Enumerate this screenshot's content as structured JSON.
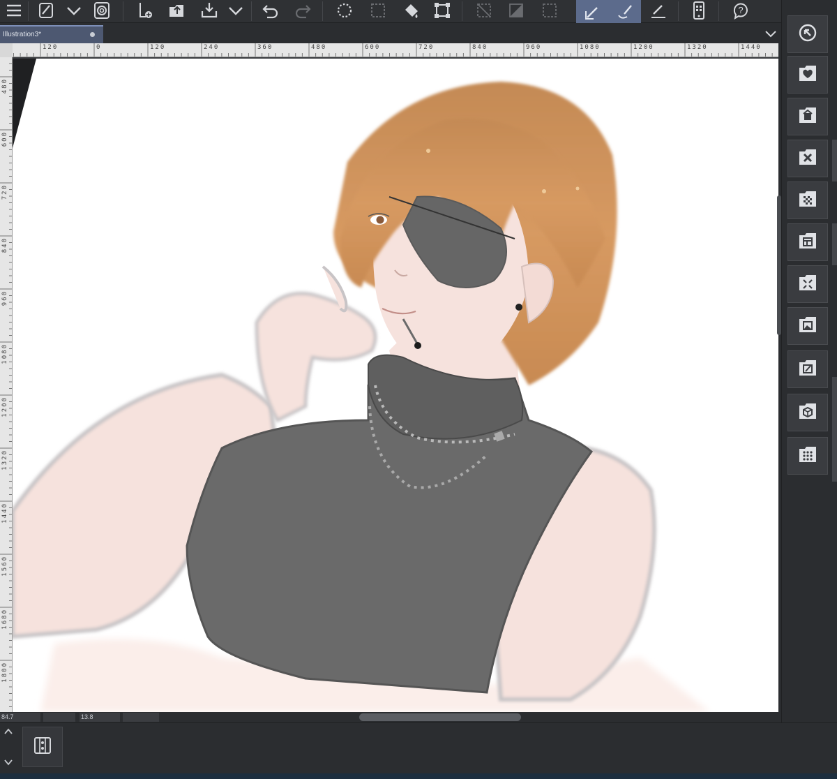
{
  "document": {
    "tab_title": "Illustration3*",
    "modified": true
  },
  "toolbar": {
    "icons": [
      "menu-icon",
      "pen-settings-icon",
      "dropdown-icon",
      "companion-icon",
      "new-canvas-icon",
      "open-icon",
      "save-icon",
      "dropdown-icon",
      "undo-icon",
      "redo-icon",
      "selection-launcher-icon",
      "select-area-icon",
      "fill-icon",
      "transform-icon",
      "clear-selection-icon",
      "invert-selection-icon",
      "deselect-icon",
      "pen-tool-icon",
      "brush-tool-icon",
      "eraser-tool-icon",
      "smartphone-icon",
      "help-icon"
    ],
    "active_tools": [
      "pen-tool-icon",
      "brush-tool-icon"
    ]
  },
  "ruler": {
    "horizontal_labels": [
      "120",
      "0",
      "120",
      "240",
      "360",
      "480",
      "600",
      "720",
      "840",
      "960",
      "1080",
      "1200",
      "1320",
      "1440"
    ],
    "vertical_labels": [
      "480",
      "600",
      "720",
      "840",
      "960",
      "1080",
      "1200",
      "1320",
      "1440",
      "1560",
      "1680",
      "1800"
    ]
  },
  "status": {
    "zoom": "84.7",
    "rotation": "13.8"
  },
  "sidebar": {
    "icons": [
      "navigator-icon",
      "favorites-icon",
      "material-icon",
      "close-panel-icon",
      "pattern-icon",
      "layout-icon",
      "sub-tool-icon",
      "image-material-icon",
      "edit-icon",
      "3d-material-icon",
      "grid-icon"
    ]
  },
  "bottom_panel": {
    "icons": [
      "collapse-up-icon",
      "expand-down-icon",
      "timeline-icon"
    ]
  },
  "colors": {
    "accent": "#5c6b8c",
    "tab_active": "#4d5871",
    "hair": "#c98a4f",
    "skin": "#f6e2dd",
    "sweater": "#6a6a6a"
  }
}
